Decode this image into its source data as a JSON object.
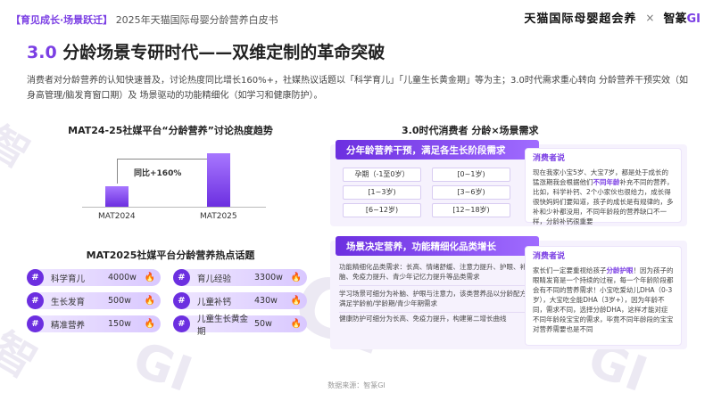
{
  "header": {
    "section_tag": "【育见成长·场景跃迁】",
    "report_title": "2025年天猫国际母婴分龄营养白皮书",
    "brand_left": "天猫国际母婴超会养",
    "brand_sep": "×",
    "brand_right_a": "智篆",
    "brand_right_b": "GI"
  },
  "page": {
    "title_num": "3.0",
    "title_text": "分龄场景专研时代——双维定制的革命突破",
    "intro": "消费者对分龄营养的认知快速普及，讨论热度同比增长160%+，社媒热议话题以「科学育儿」「儿童生长黄金期」等为主；3.0时代需求重心转向 分龄营养干预实效（如身高管理/脑发育窗口期）及 场景驱动的功能精细化（如学习和健康防护）。"
  },
  "left_chart": {
    "title": "MAT24-25社媒平台“分龄营养”讨论热度趋势",
    "growth_label": "同比+160%"
  },
  "chart_data": {
    "type": "bar",
    "categories": [
      "MAT2024",
      "MAT2025"
    ],
    "values": [
      1,
      2.6
    ],
    "annotations": [
      "同比+160%"
    ],
    "title": "MAT24-25社媒平台“分龄营养”讨论热度趋势",
    "xlabel": "",
    "ylabel": ""
  },
  "topics": {
    "title": "MAT2025社媒平台分龄营养热点话题",
    "hash": "#",
    "flame": "🔥",
    "items": [
      {
        "name": "科学育儿",
        "value": "4000w"
      },
      {
        "name": "育儿经验",
        "value": "3300w"
      },
      {
        "name": "生长发育",
        "value": "500w"
      },
      {
        "name": "儿童补钙",
        "value": "430w"
      },
      {
        "name": "精准营养",
        "value": "150w"
      },
      {
        "name": "儿童生长黄金期",
        "value": "50w"
      }
    ]
  },
  "right": {
    "title": "3.0时代消费者 分龄×场景需求",
    "section1": {
      "band": "分年龄营养干预，满足各生长阶段需求",
      "ages": [
        "孕期（-1至0岁）",
        "[0~1岁)",
        "[1~3岁)",
        "[3~6岁)",
        "[6~12岁)",
        "[12~18岁)"
      ],
      "quote_title": "消费者说",
      "quote_a": "现在我家小宝5岁、大宝7岁，都是处于成长的猛涨期我会根据他们",
      "quote_hl": "不同年龄",
      "quote_b": "补充不同的营养，比如，科学补钙、2个小家伙也很给力，成长得很快妈妈们要知道，孩子的成长是有规律的，多补和少补都没用，不同年龄段的营养缺口不一样，分龄补钙很重要"
    },
    "section2": {
      "band": "场景决定营养，功能精细化品类增长",
      "lines": [
        "功能精细化品类需求：长高、情绪舒缓、注意力提升、护眼、补脑、免疫力提升、青少年记忆力提升等品类需求",
        "学习场景可细分为补脑、护眼与注意力，该类营养品以分龄配方满足学龄前/学龄期/青少年期需求",
        "健康防护可细分为长高、免疫力提升，构建第二增长曲线"
      ],
      "quote_title": "消费者说",
      "quote_a": "家长们一定要重视给孩子",
      "quote_hl": "分龄护眼",
      "quote_b": "！因为孩子的眼睛发育是一个持续的过程，每一个年龄阶段都会有不同的营养需求！小宝吃爱幼儿DHA（0-3岁），大宝吃全能DHA（3岁+），因为年龄不同，需求不同，选择分龄DHA，这样才能对症不同年龄段宝宝的需求，毕竟不同年龄段的宝宝对营养需要也是不同"
    }
  },
  "footer": {
    "source": "数据来源：智篆GI"
  }
}
